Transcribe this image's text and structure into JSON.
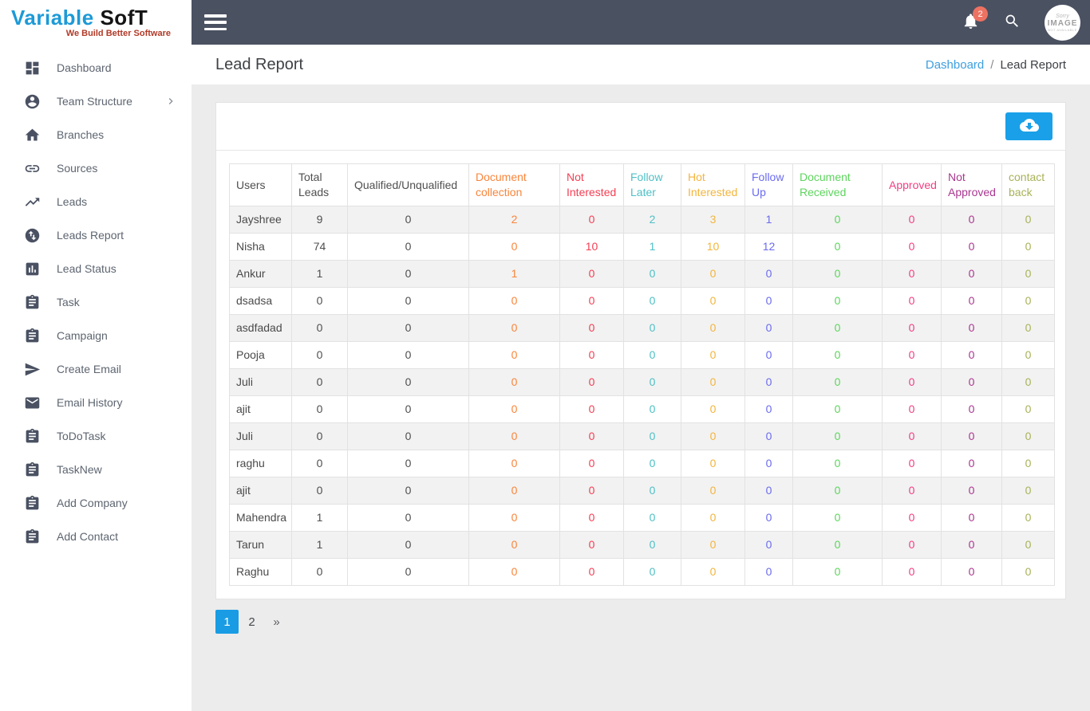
{
  "logo": {
    "brand_first": "Variable",
    "brand_second": "SofT",
    "tagline": "We Build Better Software"
  },
  "sidebar": {
    "items": [
      {
        "label": "Dashboard",
        "icon": "dashboard-icon"
      },
      {
        "label": "Team Structure",
        "icon": "person-circle-icon",
        "has_submenu": true
      },
      {
        "label": "Branches",
        "icon": "home-icon"
      },
      {
        "label": "Sources",
        "icon": "link-icon"
      },
      {
        "label": "Leads",
        "icon": "trending-up-icon"
      },
      {
        "label": "Leads Report",
        "icon": "swap-vert-circle-icon"
      },
      {
        "label": "Lead Status",
        "icon": "bar-chart-icon"
      },
      {
        "label": "Task",
        "icon": "clipboard-icon"
      },
      {
        "label": "Campaign",
        "icon": "clipboard-icon"
      },
      {
        "label": "Create Email",
        "icon": "send-icon"
      },
      {
        "label": "Email History",
        "icon": "email-icon"
      },
      {
        "label": "ToDoTask",
        "icon": "clipboard-icon"
      },
      {
        "label": "TaskNew",
        "icon": "clipboard-icon"
      },
      {
        "label": "Add Company",
        "icon": "clipboard-icon"
      },
      {
        "label": "Add Contact",
        "icon": "clipboard-icon"
      }
    ]
  },
  "topbar": {
    "menu_icon": "menu-icon",
    "notifications_icon": "bell-icon",
    "search_icon": "search-icon",
    "notification_count": "2",
    "avatar": {
      "line1": "Sorry",
      "line2": "IMAGE",
      "line3": "NOT AVAILABLE"
    }
  },
  "page": {
    "title": "Lead Report",
    "breadcrumb": {
      "link": "Dashboard",
      "separator": "/",
      "current": "Lead Report"
    }
  },
  "toolbar": {
    "download_icon": "cloud-download-icon"
  },
  "table": {
    "columns": [
      {
        "label": "Users",
        "color": "#4f4f4f"
      },
      {
        "label": "Total Leads",
        "color": "#4f4f4f"
      },
      {
        "label": "Qualified/Unqualified",
        "color": "#4f4f4f"
      },
      {
        "label": "Document collection",
        "color": "#f9853b"
      },
      {
        "label": "Not Interested",
        "color": "#f43f53"
      },
      {
        "label": "Follow Later",
        "color": "#4fc0c6"
      },
      {
        "label": "Hot Interested",
        "color": "#f3b53d"
      },
      {
        "label": "Follow Up",
        "color": "#6b6bef"
      },
      {
        "label": "Document Received",
        "color": "#5ed45e"
      },
      {
        "label": "Approved",
        "color": "#f23e83"
      },
      {
        "label": "Not Approved",
        "color": "#aa3790"
      },
      {
        "label": "contact back",
        "color": "#a9b257"
      }
    ],
    "rows": [
      {
        "user": "Jayshree",
        "values": [
          9,
          0,
          2,
          0,
          2,
          3,
          1,
          0,
          0,
          0,
          0
        ]
      },
      {
        "user": "Nisha",
        "values": [
          74,
          0,
          0,
          10,
          1,
          10,
          12,
          0,
          0,
          0,
          0
        ]
      },
      {
        "user": "Ankur",
        "values": [
          1,
          0,
          1,
          0,
          0,
          0,
          0,
          0,
          0,
          0,
          0
        ]
      },
      {
        "user": "dsadsa",
        "values": [
          0,
          0,
          0,
          0,
          0,
          0,
          0,
          0,
          0,
          0,
          0
        ]
      },
      {
        "user": "asdfadad",
        "values": [
          0,
          0,
          0,
          0,
          0,
          0,
          0,
          0,
          0,
          0,
          0
        ]
      },
      {
        "user": "Pooja",
        "values": [
          0,
          0,
          0,
          0,
          0,
          0,
          0,
          0,
          0,
          0,
          0
        ]
      },
      {
        "user": "Juli",
        "values": [
          0,
          0,
          0,
          0,
          0,
          0,
          0,
          0,
          0,
          0,
          0
        ]
      },
      {
        "user": "ajit",
        "values": [
          0,
          0,
          0,
          0,
          0,
          0,
          0,
          0,
          0,
          0,
          0
        ]
      },
      {
        "user": "Juli",
        "values": [
          0,
          0,
          0,
          0,
          0,
          0,
          0,
          0,
          0,
          0,
          0
        ]
      },
      {
        "user": "raghu",
        "values": [
          0,
          0,
          0,
          0,
          0,
          0,
          0,
          0,
          0,
          0,
          0
        ]
      },
      {
        "user": "ajit",
        "values": [
          0,
          0,
          0,
          0,
          0,
          0,
          0,
          0,
          0,
          0,
          0
        ]
      },
      {
        "user": "Mahendra",
        "values": [
          1,
          0,
          0,
          0,
          0,
          0,
          0,
          0,
          0,
          0,
          0
        ]
      },
      {
        "user": "Tarun",
        "values": [
          1,
          0,
          0,
          0,
          0,
          0,
          0,
          0,
          0,
          0,
          0
        ]
      },
      {
        "user": "Raghu",
        "values": [
          0,
          0,
          0,
          0,
          0,
          0,
          0,
          0,
          0,
          0,
          0
        ]
      }
    ]
  },
  "pagination": {
    "items": [
      {
        "label": "1",
        "active": true
      },
      {
        "label": "2",
        "active": false
      },
      {
        "label": "»",
        "active": false,
        "is_next": true
      }
    ]
  },
  "colors": {
    "topbar_background": "#4a5161",
    "accent_blue": "#19a0e8",
    "badge_red": "#ee7262",
    "link_blue": "#3d9fe0",
    "row_stripe": "#f2f2f2"
  }
}
